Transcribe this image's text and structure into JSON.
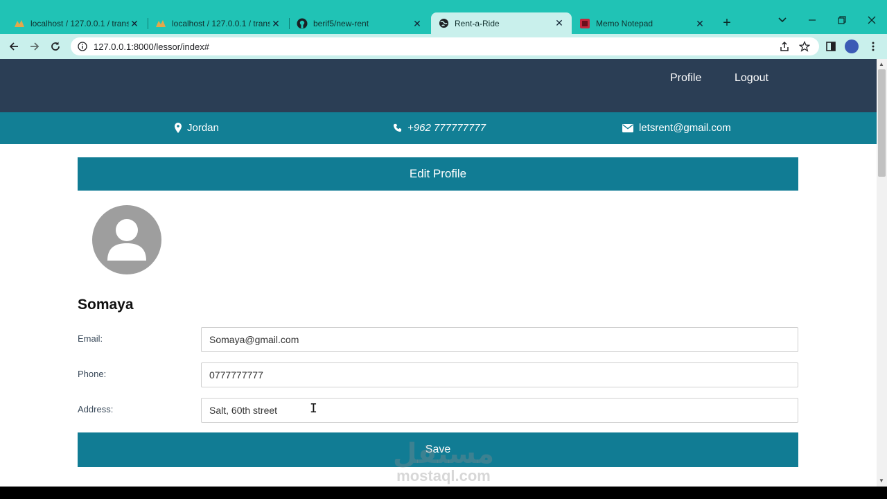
{
  "browser": {
    "tabs": [
      {
        "title": "localhost / 127.0.0.1 / transp",
        "icon": "phpmyadmin-icon",
        "active": false
      },
      {
        "title": "localhost / 127.0.0.1 / transp",
        "icon": "phpmyadmin-icon",
        "active": false
      },
      {
        "title": "berif5/new-rent",
        "icon": "github-icon",
        "active": false
      },
      {
        "title": "Rent-a-Ride",
        "icon": "globe-icon",
        "active": true
      },
      {
        "title": "Memo Notepad",
        "icon": "notepad-icon",
        "active": false
      }
    ],
    "new_tab": "+",
    "url": "127.0.0.1:8000/lessor/index#",
    "colors": {
      "tabstrip": "#20c3b5",
      "toolbar": "#c9f0ec"
    }
  },
  "navbar": {
    "links": [
      "Profile",
      "Logout"
    ]
  },
  "infobar": {
    "location": "Jordan",
    "phone": "+962 777777777",
    "email": "letsrent@gmail.com"
  },
  "page": {
    "banner_title": "Edit Profile",
    "username": "Somaya",
    "fields": {
      "email": {
        "label": "Email:",
        "value": "Somaya@gmail.com"
      },
      "phone": {
        "label": "Phone:",
        "value": "0777777777"
      },
      "address": {
        "label": "Address:",
        "value": "Salt, 60th street"
      }
    },
    "save_label": "Save",
    "colors": {
      "navbar": "#2b3e55",
      "accent": "#117c94"
    }
  },
  "watermark": {
    "arabic": "مستقل",
    "latin": "mostaql.com"
  }
}
